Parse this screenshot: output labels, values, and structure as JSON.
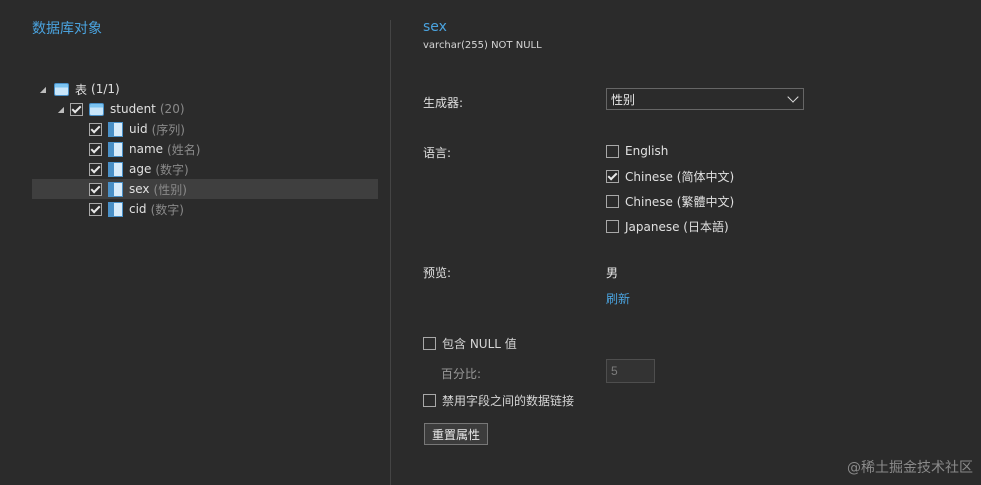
{
  "left": {
    "title": "数据库对象",
    "tables_node": {
      "label": "表",
      "count": "(1/1)"
    },
    "table": {
      "label": "student",
      "count": "(20)"
    },
    "columns": [
      {
        "name": "uid",
        "type": "(序列)"
      },
      {
        "name": "name",
        "type": "(姓名)"
      },
      {
        "name": "age",
        "type": "(数字)"
      },
      {
        "name": "sex",
        "type": "(性别)"
      },
      {
        "name": "cid",
        "type": "(数字)"
      }
    ]
  },
  "right": {
    "field_name": "sex",
    "field_type": "varchar(255) NOT NULL",
    "generator_label": "生成器:",
    "generator_value": "性别",
    "language_label": "语言:",
    "languages": [
      {
        "label": "English",
        "checked": false
      },
      {
        "label": "Chinese (简体中文)",
        "checked": true
      },
      {
        "label": "Chinese (繁體中文)",
        "checked": false
      },
      {
        "label": "Japanese (日本語)",
        "checked": false
      }
    ],
    "preview_label": "预览:",
    "preview_value": "男",
    "refresh_label": "刷新",
    "include_null_label": "包含 NULL 值",
    "percent_label": "百分比:",
    "percent_value": "5",
    "disable_link_label": "禁用字段之间的数据链接",
    "reset_button_label": "重置属性"
  },
  "watermark": "@稀土掘金技术社区"
}
